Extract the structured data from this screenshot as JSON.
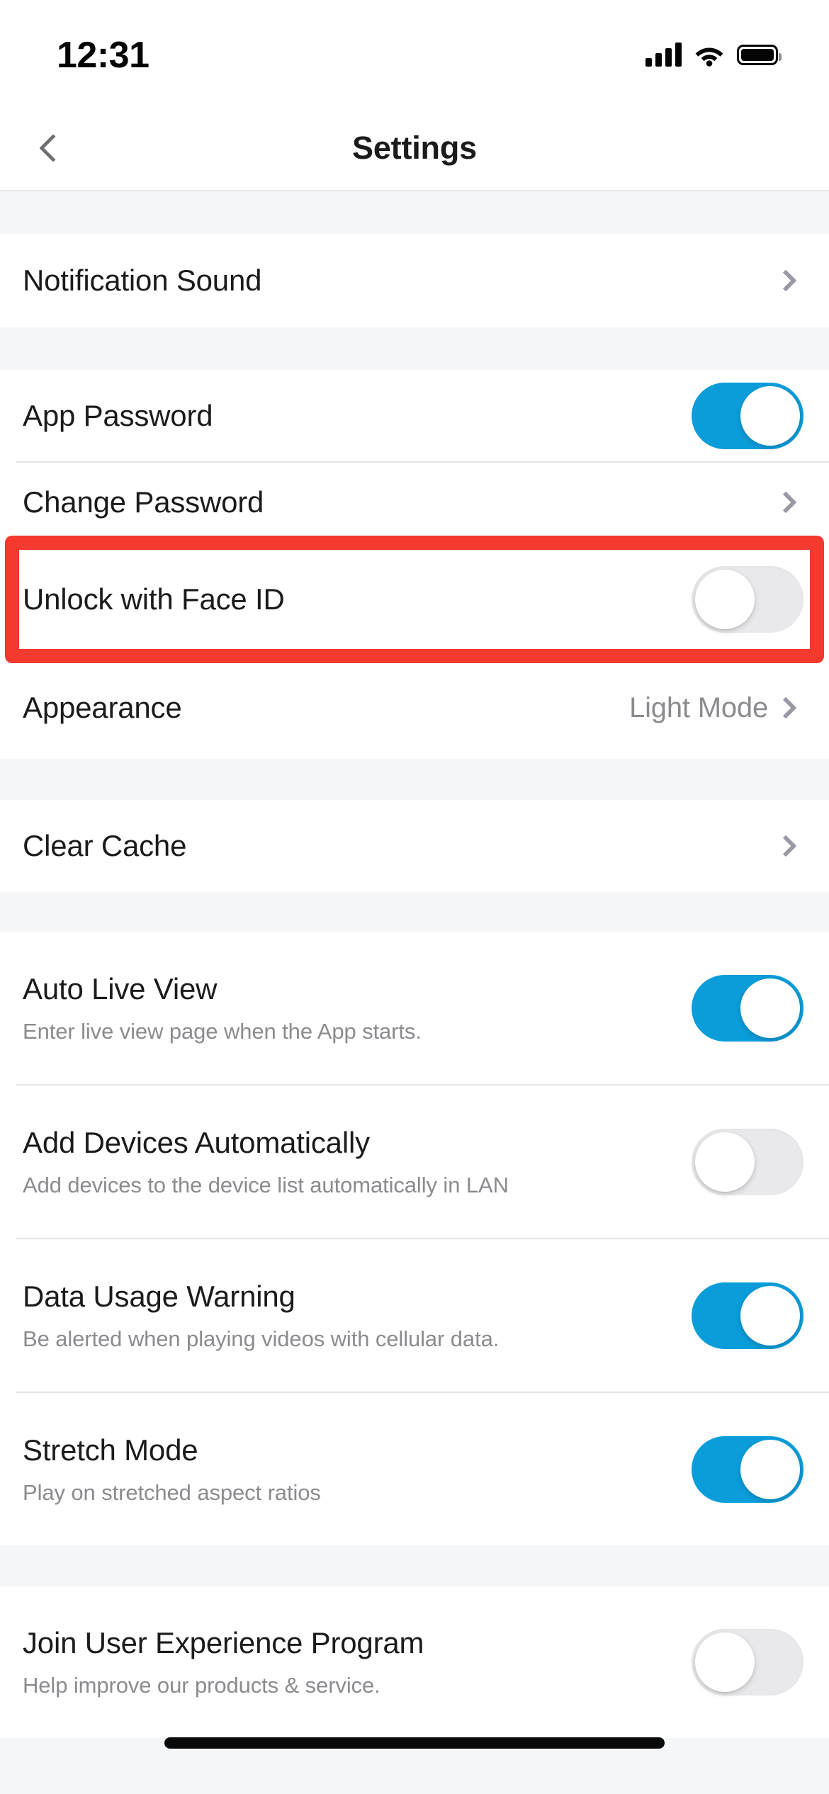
{
  "status_bar": {
    "time": "12:31",
    "signal_icon": "cellular-signal-icon",
    "wifi_icon": "wifi-icon",
    "battery_icon": "battery-full-icon"
  },
  "nav_bar": {
    "back_icon": "chevron-left-icon",
    "title": "Settings"
  },
  "colors": {
    "toggle_on": "#0b9dda",
    "toggle_off": "#e9e9eb",
    "highlight": "#f4392f",
    "background": "#f5f6f8",
    "row_background": "#ffffff",
    "title_text": "#1b1b1b",
    "subtitle_text": "#8b8b90",
    "chevron": "#9a9aa6"
  },
  "sections": [
    {
      "rows": [
        {
          "title": "Notification Sound",
          "type": "disclosure",
          "value": "",
          "chevron_icon": "chevron-right-icon"
        }
      ]
    },
    {
      "rows": [
        {
          "title": "App Password",
          "type": "toggle",
          "toggle_state": "on"
        },
        {
          "title": "Change Password",
          "type": "disclosure",
          "value": "",
          "chevron_icon": "chevron-right-icon"
        },
        {
          "title": "Unlock with Face ID",
          "type": "toggle",
          "toggle_state": "off",
          "highlighted": "true"
        },
        {
          "title": "Appearance",
          "type": "disclosure",
          "value": "Light Mode",
          "chevron_icon": "chevron-right-icon"
        }
      ]
    },
    {
      "rows": [
        {
          "title": "Clear Cache",
          "type": "disclosure",
          "value": "",
          "chevron_icon": "chevron-right-icon"
        }
      ]
    },
    {
      "rows": [
        {
          "title": "Auto Live View",
          "subtitle": "Enter live view page when the App starts.",
          "type": "toggle",
          "toggle_state": "on"
        },
        {
          "title": "Add Devices Automatically",
          "subtitle": "Add devices to the device list automatically in LAN",
          "type": "toggle",
          "toggle_state": "off"
        },
        {
          "title": "Data Usage Warning",
          "subtitle": "Be alerted when playing videos with cellular data.",
          "type": "toggle",
          "toggle_state": "on"
        },
        {
          "title": "Stretch Mode",
          "subtitle": "Play on stretched aspect ratios",
          "type": "toggle",
          "toggle_state": "on"
        }
      ]
    },
    {
      "rows": [
        {
          "title": "Join User Experience Program",
          "subtitle": "Help improve our products & service.",
          "type": "toggle",
          "toggle_state": "off"
        }
      ]
    }
  ],
  "home_indicator": "home-indicator-bar"
}
